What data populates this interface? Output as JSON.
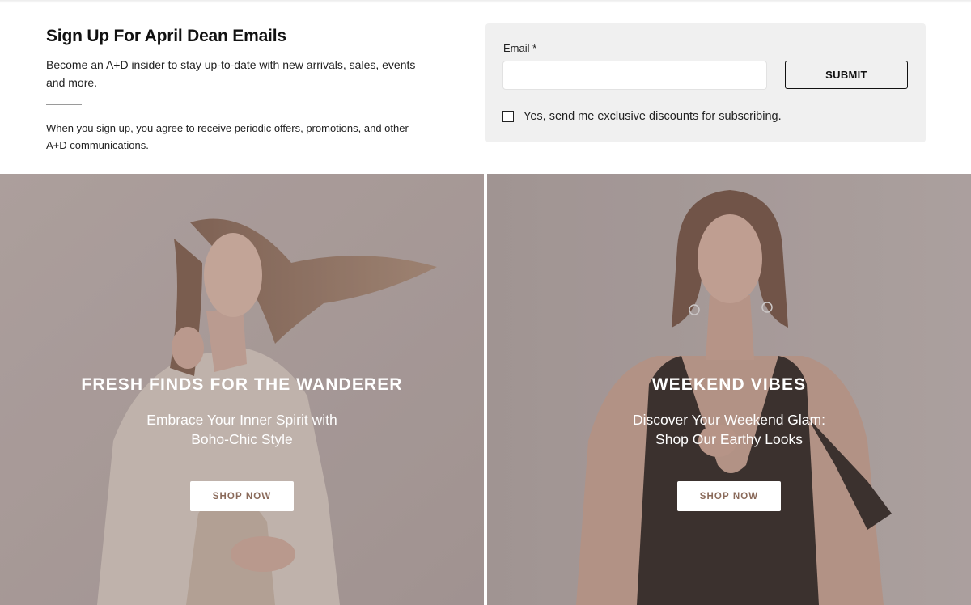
{
  "signup": {
    "title": "Sign Up For April Dean Emails",
    "description": "Become an A+D insider to stay up-to-date with new arrivals, sales, events and more.",
    "legal": "When you sign up, you agree to receive periodic offers, promotions, and other A+D communications.",
    "form": {
      "email_label": "Email *",
      "email_value": "",
      "submit_label": "SUBMIT",
      "consent_label": "Yes, send me exclusive discounts for subscribing.",
      "consent_checked": false
    }
  },
  "panels": [
    {
      "title": "FRESH FINDS FOR THE WANDERER",
      "subtitle": "Embrace Your Inner Spirit with Boho-Chic Style",
      "button_label": "SHOP NOW"
    },
    {
      "title": "WEEKEND VIBES",
      "subtitle": "Discover Your Weekend Glam: Shop Our Earthy Looks",
      "button_label": "SHOP NOW"
    }
  ],
  "colors": {
    "form_bg": "#f0f0f0",
    "button_text": "#8a6a5a",
    "panel_text": "#ffffff"
  }
}
